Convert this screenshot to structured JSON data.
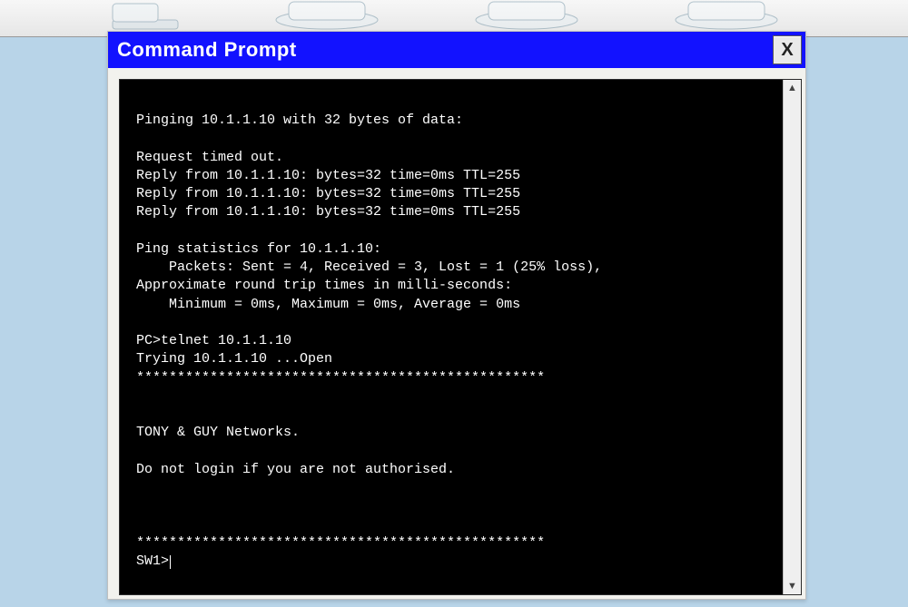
{
  "window": {
    "title": "Command Prompt",
    "close_glyph": "X"
  },
  "terminal": {
    "lines": [
      "Pinging 10.1.1.10 with 32 bytes of data:",
      "",
      "Request timed out.",
      "Reply from 10.1.1.10: bytes=32 time=0ms TTL=255",
      "Reply from 10.1.1.10: bytes=32 time=0ms TTL=255",
      "Reply from 10.1.1.10: bytes=32 time=0ms TTL=255",
      "",
      "Ping statistics for 10.1.1.10:",
      "    Packets: Sent = 4, Received = 3, Lost = 1 (25% loss),",
      "Approximate round trip times in milli-seconds:",
      "    Minimum = 0ms, Maximum = 0ms, Average = 0ms",
      "",
      "PC>telnet 10.1.1.10",
      "Trying 10.1.1.10 ...Open",
      "**************************************************",
      "",
      "",
      "TONY & GUY Networks.",
      "",
      "Do not login if you are not authorised.",
      "",
      "",
      "",
      "**************************************************"
    ],
    "prompt": "SW1>"
  }
}
